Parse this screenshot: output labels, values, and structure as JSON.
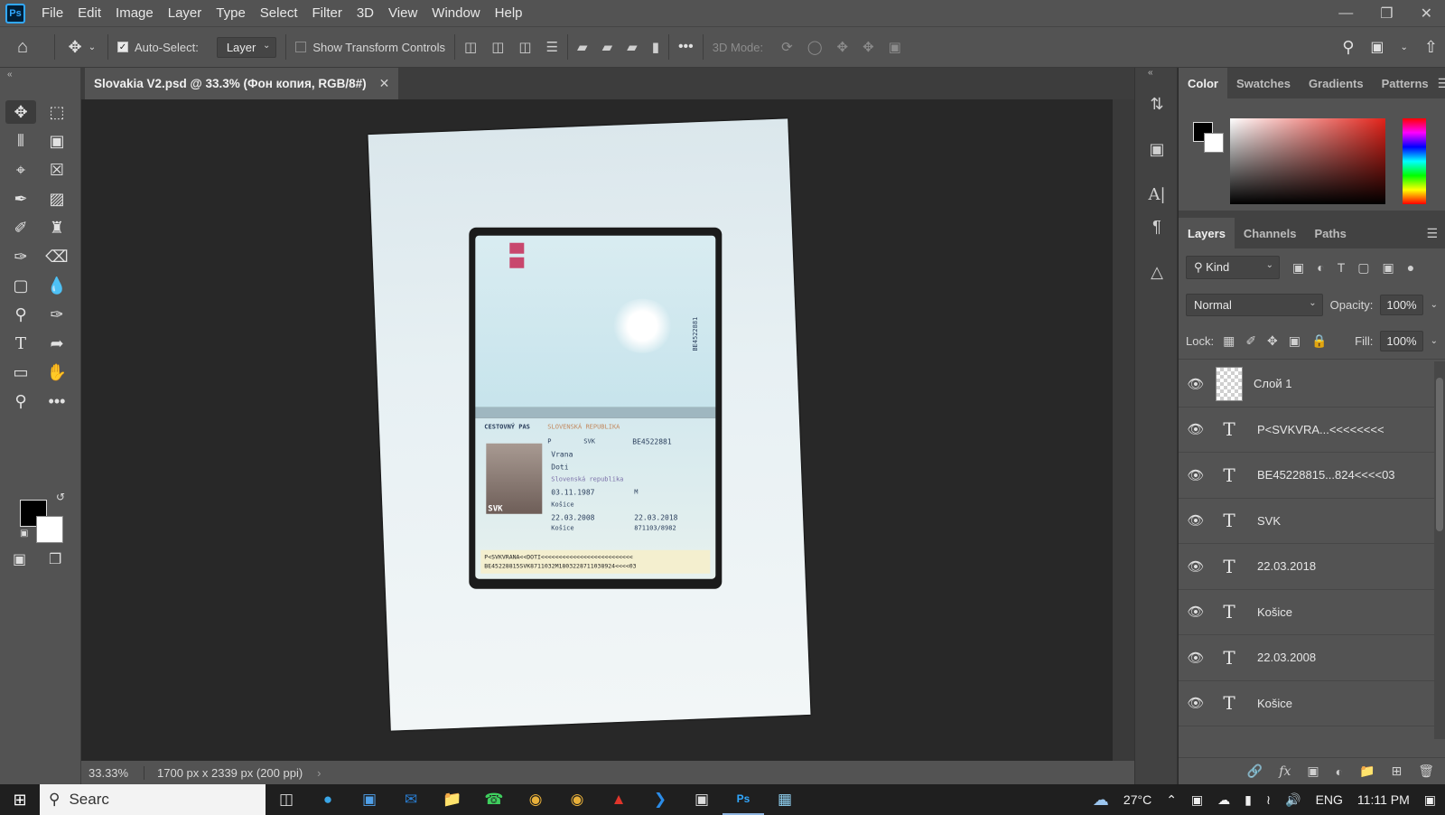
{
  "menu": [
    "File",
    "Edit",
    "Image",
    "Layer",
    "Type",
    "Select",
    "Filter",
    "3D",
    "View",
    "Window",
    "Help"
  ],
  "options": {
    "auto_select_label": "Auto-Select:",
    "auto_select_value": "Layer",
    "show_transform_label": "Show Transform Controls",
    "mode_3d_label": "3D Mode:"
  },
  "document": {
    "tab_title": "Slovakia V2.psd @ 33.3% (Фон копия, RGB/8#)",
    "zoom": "33.33%",
    "info": "1700 px x 2339 px (200 ppi)"
  },
  "passport": {
    "header": "CESTOVNÝ PAS",
    "country": "SLOVENSKÁ REPUBLIKA",
    "type": "P",
    "code": "SVK",
    "number": "BE4522881",
    "surname": "Vrana",
    "given": "Doti",
    "nationality": "Slovenská republika",
    "dob": "03.11.1987",
    "sex": "M",
    "pob": "Košice",
    "issue": "22.03.2008",
    "expiry": "22.03.2018",
    "authority": "Košice",
    "personal_no": "871103/8982",
    "photo_code": "SVK",
    "side_number": "BE4522881",
    "mrz1": "P<SVKVRANA<<DOTI<<<<<<<<<<<<<<<<<<<<<<<<<<",
    "mrz2": "BE45228815SVK8711032M1803228711038924<<<<03"
  },
  "color_panel": {
    "tabs": [
      "Color",
      "Swatches",
      "Gradients",
      "Patterns"
    ]
  },
  "layers_panel": {
    "tabs": [
      "Layers",
      "Channels",
      "Paths"
    ],
    "kind_label": "Kind",
    "blend_mode": "Normal",
    "opacity_label": "Opacity:",
    "opacity_value": "100%",
    "lock_label": "Lock:",
    "fill_label": "Fill:",
    "fill_value": "100%",
    "layers": [
      {
        "name": "Слой 1",
        "type": "pixel"
      },
      {
        "name": "P<SVKVRA...<<<<<<<<",
        "type": "text"
      },
      {
        "name": "BE45228815...824<<<<03",
        "type": "text"
      },
      {
        "name": "SVK",
        "type": "text"
      },
      {
        "name": "22.03.2018",
        "type": "text"
      },
      {
        "name": "Košice",
        "type": "text"
      },
      {
        "name": "22.03.2008",
        "type": "text"
      },
      {
        "name": "Košice",
        "type": "text"
      }
    ]
  },
  "taskbar": {
    "search_placeholder": "Searc",
    "weather": "27°C",
    "language": "ENG",
    "time": "11:11 PM"
  }
}
